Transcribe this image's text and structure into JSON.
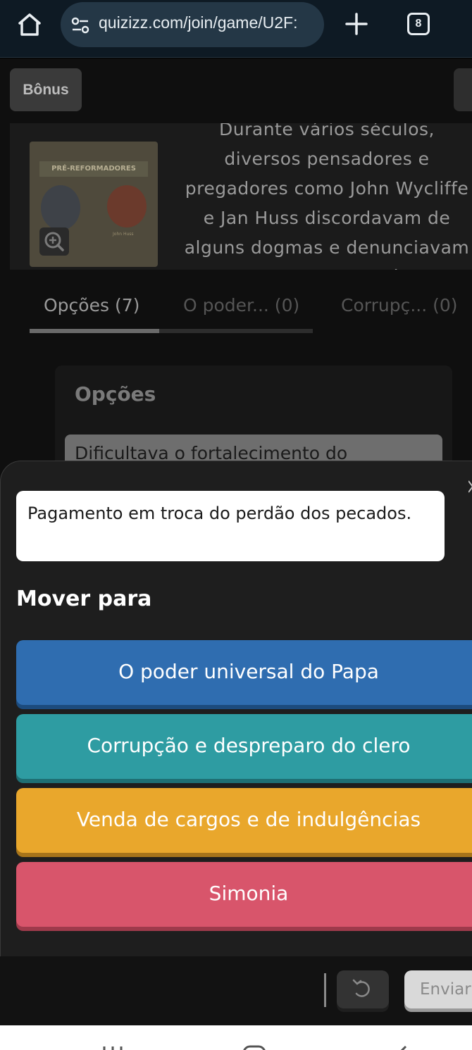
{
  "browser": {
    "url": "quizizz.com/join/game/U2F:",
    "tab_count": "8"
  },
  "quiz": {
    "bonus_label": "Bônus",
    "image_caption": "PRÉ-REFORMADORES",
    "image_subcaption": "John Huss",
    "question_text": "Durante vários séculos, diversos pensadores e pregadores como John Wycliffe e Jan Huss discordavam de alguns dogmas e denunciavam abusos de poder político e religioso das",
    "tabs": [
      {
        "label": "Opções (7)"
      },
      {
        "label": "O poder... (0)"
      },
      {
        "label": "Corrupç... (0)"
      }
    ],
    "options_panel_title": "Opções",
    "option_card_text": "Dificultava o fortalecimento do"
  },
  "sheet": {
    "selected_option": "Pagamento em troca do perdão dos pecados.",
    "move_title": "Mover para",
    "targets": [
      {
        "label": "O poder universal do Papa",
        "color": "#2f6db0"
      },
      {
        "label": "Corrupção e despreparo do clero",
        "color": "#2e9ca2"
      },
      {
        "label": "Venda de cargos e de indulgências",
        "color": "#e9a72c"
      },
      {
        "label": "Simonia",
        "color": "#d8556b"
      }
    ]
  },
  "actions": {
    "submit_label": "Enviar"
  },
  "icons": [
    "home-icon",
    "site-info-icon",
    "plus-icon",
    "tabs-icon",
    "zoom-in-icon",
    "undo-icon"
  ]
}
